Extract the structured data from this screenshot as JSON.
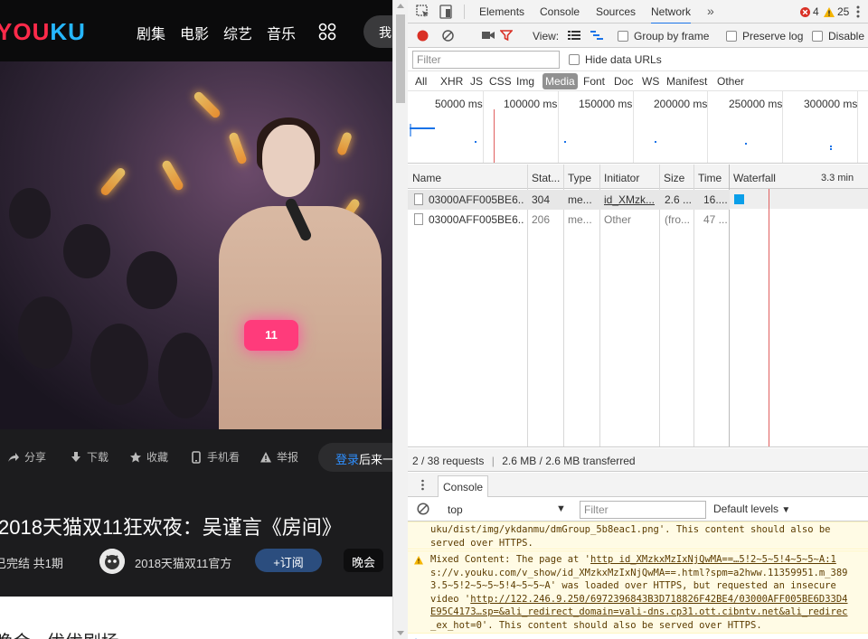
{
  "page": {
    "logo": "YOUKU",
    "nav": [
      "剧集",
      "电影",
      "综艺",
      "音乐"
    ],
    "search_text": "我",
    "actions": [
      "分享",
      "下载",
      "收藏",
      "手机看",
      "举报"
    ],
    "login_blue": "登录",
    "login_white": "后来一",
    "title": "2018天猫双11狂欢夜：吴谨言《房间》",
    "episodes": "已完结 共1期",
    "channel_name": "2018天猫双11官方",
    "subscribe": "+订阅",
    "tag": "晚会",
    "bottom_text": "晚会  ·  优优剧场",
    "video_badge": "11"
  },
  "devtools": {
    "tabs": [
      "Elements",
      "Console",
      "Sources",
      "Network"
    ],
    "active_tab": "Network",
    "more": "»",
    "errors": "4",
    "warnings": "25",
    "toolbar": {
      "view_label": "View:",
      "group_by_frame": "Group by frame",
      "preserve_log": "Preserve log",
      "disable_cache": "Disable"
    },
    "filter_placeholder": "Filter",
    "hide_data_urls": "Hide data URLs",
    "types": [
      "All",
      "XHR",
      "JS",
      "CSS",
      "Img",
      "Media",
      "Font",
      "Doc",
      "WS",
      "Manifest",
      "Other"
    ],
    "active_type": "Media",
    "overview_ticks": [
      "50000 ms",
      "100000 ms",
      "150000 ms",
      "200000 ms",
      "250000 ms",
      "300000 ms"
    ],
    "columns": [
      "Name",
      "Stat...",
      "Type",
      "Initiator",
      "Size",
      "Time",
      "Waterfall"
    ],
    "waterfall_scale": "3.3 min",
    "requests": [
      {
        "name": "03000AFF005BE6...",
        "status": "304",
        "type": "me...",
        "initiator": "id_XMzk...",
        "size": "2.6 ...",
        "time": "16...."
      },
      {
        "name": "03000AFF005BE6...",
        "status": "206",
        "type": "me...",
        "initiator": "Other",
        "size": "(fro...",
        "time": "47 ..."
      }
    ],
    "summary": {
      "requests": "2 / 38 requests",
      "transferred": "2.6 MB / 2.6 MB transferred"
    },
    "drawer_tab": "Console",
    "console": {
      "context": "top",
      "filter_placeholder": "Filter",
      "levels": "Default levels",
      "msg1_lines": [
        "uku/dist/img/ykdanmu/dmGroup_5b8eac1.png'. This content should also be",
        "served over HTTPS."
      ],
      "msg2_line1_prefix": "Mixed Content: The page at '",
      "msg2_line1_link": "http  id_XMzkxMzIxNjQwMA==…5!2~5~5!4~5~5~A:1",
      "msg2_line2": "s://v.youku.com/v_show/id_XMzkxMzIxNjQwMA==.html?spm=a2hww.11359951.m_389",
      "msg2_line3": "3.5~5!2~5~5~5!4~5~5~A' was loaded over HTTPS, but requested an insecure",
      "msg2_line4_prefix": "video '",
      "msg2_line4_link": "http://122.246.9.250/6972396843B3D718826F42BE4/03000AFF005BE6D33D4",
      "msg2_line5": "E95C4173…sp=&ali_redirect_domain=vali-dns.cp31.ott.cibntv.net&ali_redirec",
      "msg2_line6": "_ex_hot=0'. This content should also be served over HTTPS."
    },
    "colors": {
      "accent_blue": "#1a73e8",
      "error_red": "#d93025",
      "warning_yellow": "#f4b400",
      "waterfall_bar": "#0b9fe9"
    }
  }
}
